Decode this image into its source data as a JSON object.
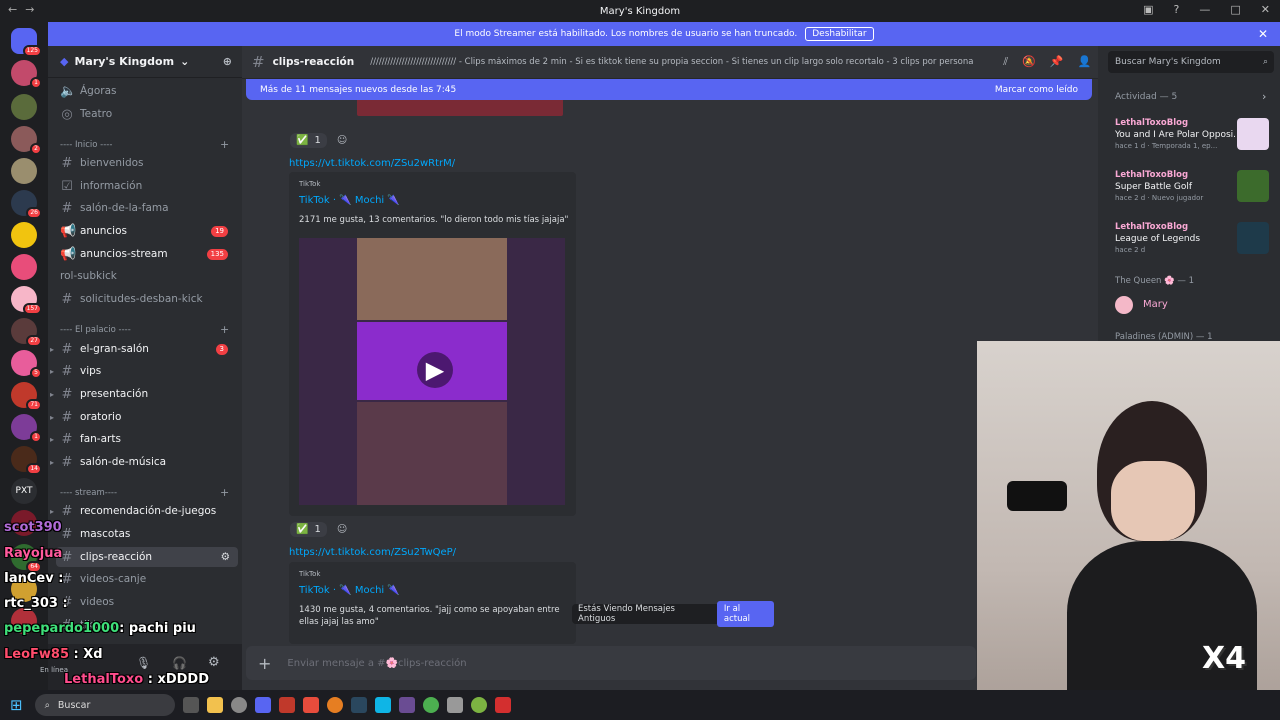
{
  "window": {
    "title": "Mary's Kingdom"
  },
  "banner": {
    "text": "El modo Streamer está habilitado. Los nombres de usuario se han truncado.",
    "button": "Deshabilitar"
  },
  "server": {
    "name": "Mary's Kingdom"
  },
  "channels": {
    "voice": [
      {
        "label": "Ágoras"
      },
      {
        "label": "Teatro"
      }
    ],
    "cat_inicio": "---- Inicio ----",
    "inicio": [
      {
        "label": "bienvenidos",
        "badge": ""
      },
      {
        "label": "información",
        "badge": ""
      },
      {
        "label": "salón-de-la-fama",
        "badge": ""
      },
      {
        "label": "anuncios",
        "badge": "19"
      },
      {
        "label": "anuncios-stream",
        "badge": "135"
      },
      {
        "label": "rol-subkick",
        "badge": ""
      },
      {
        "label": "solicitudes-desban-kick",
        "badge": ""
      }
    ],
    "cat_palacio": "---- El palacio ----",
    "palacio": [
      {
        "label": "el-gran-salón",
        "badge": "3"
      },
      {
        "label": "vips",
        "badge": ""
      },
      {
        "label": "presentación",
        "badge": ""
      },
      {
        "label": "oratorio",
        "badge": ""
      },
      {
        "label": "fan-arts",
        "badge": ""
      },
      {
        "label": "salón-de-música",
        "badge": ""
      }
    ],
    "cat_stream": "---- stream----",
    "stream": [
      {
        "label": "recomendación-de-juegos"
      },
      {
        "label": "mascotas"
      },
      {
        "label": "clips-reacción"
      },
      {
        "label": "videos-canje"
      },
      {
        "label": "videos"
      },
      {
        "label": "tiktoks"
      }
    ]
  },
  "user": {
    "status": "En línea"
  },
  "chat": {
    "channel_name": "clips-reacción",
    "topic": "////////////////////////////// - Clips máximos de 2 min - Si es tiktok tiene su propia seccion - Si tienes un clip largo solo recortalo - 3 clips por persona",
    "new_messages": "Más de 11 mensajes nuevos desde las 7:45",
    "mark_read": "Marcar como leído",
    "reaction_count": "1",
    "link1": "https://vt.tiktok.com/ZSu2wRtrM/",
    "link2": "https://vt.tiktok.com/ZSu2TwQeP/",
    "embed1": {
      "provider": "TikTok",
      "author": "TikTok · 🌂 Mochi 🌂",
      "desc": "2171 me gusta, 13 comentarios. \"lo dieron todo mis tías jajaja\""
    },
    "embed2": {
      "provider": "TikTok",
      "author": "TikTok · 🌂 Mochi 🌂",
      "desc": "1430 me gusta, 4 comentarios. \"jajj como se apoyaban entre ellas jajaj las amo\""
    },
    "old_notice": "Estás Viendo Mensajes Antiguos",
    "jump": "Ir al actual",
    "input_placeholder": "Enviar mensaje a #🌸clips-reacción"
  },
  "members": {
    "search_placeholder": "Buscar Mary's Kingdom",
    "activity_header": "Actividad — 5",
    "activities": [
      {
        "who": "LethalToxoBlog",
        "what": "You and I Are Polar Opposi...",
        "when": "hace 1 d  · Temporada 1, ep..."
      },
      {
        "who": "LethalToxoBlog",
        "what": "Super Battle Golf",
        "when": "hace 2 d  · Nuevo jugador"
      },
      {
        "who": "LethalToxoBlog",
        "what": "League of Legends",
        "when": "hace 2 d"
      }
    ],
    "role_queen": "The Queen 🌸 — 1",
    "member_mary": "Mary",
    "role_paladines": "Paladines (ADMIN) — 1"
  },
  "overlay_chat": [
    {
      "user": "scot390",
      "msg": "",
      "color": "#b06bd6"
    },
    {
      "user": "Rayojua",
      "msg": "",
      "color": "#ff5a9d"
    },
    {
      "user": "IanCev",
      "msg": ":",
      "color": "#ffffff"
    },
    {
      "user": "rtc_303",
      "msg": ":",
      "color": "#ffffff"
    },
    {
      "user": "pepepardo1000",
      "msg": ": pachi piu",
      "color": "#3fe07a"
    },
    {
      "user": "LeoFw85",
      "msg": ": Xd",
      "color": "#ff4d6d"
    },
    {
      "user": "LethalToxo",
      "msg": ": xDDDD",
      "color": "#ff4d8d"
    }
  ],
  "taskbar": {
    "search": "Buscar"
  },
  "colors": {
    "accent": "#5865f2",
    "sidebar": "#2b2d31",
    "chat_bg": "#313338",
    "link": "#00a8fc"
  }
}
